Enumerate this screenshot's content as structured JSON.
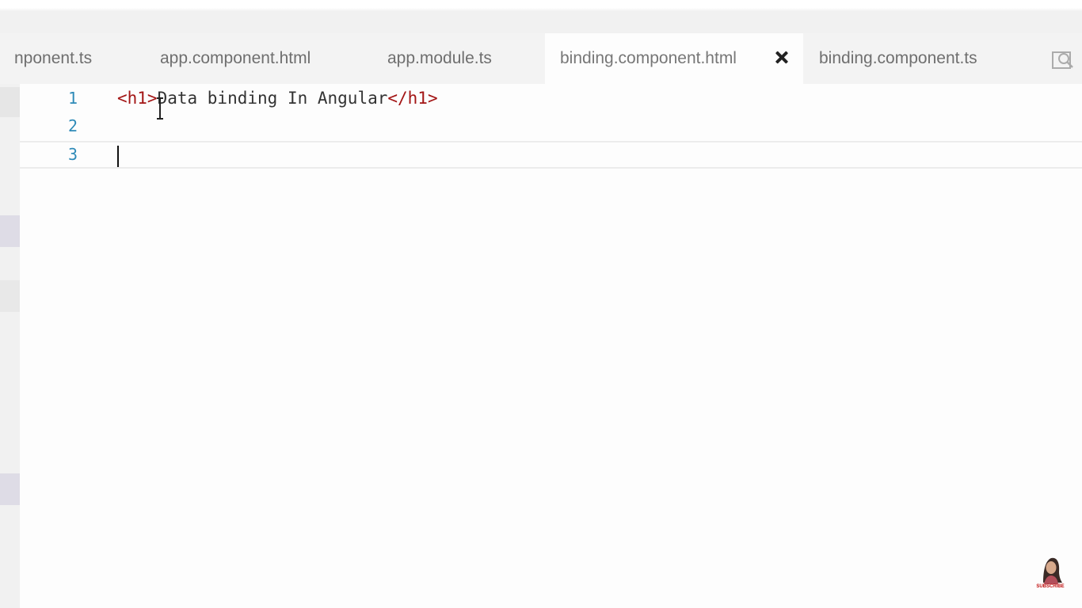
{
  "tabs": [
    {
      "label": "nponent.ts"
    },
    {
      "label": "app.component.html"
    },
    {
      "label": "app.module.ts"
    },
    {
      "label": "binding.component.html",
      "active": true
    },
    {
      "label": "binding.component.ts"
    }
  ],
  "editor": {
    "lines": [
      {
        "number": "1",
        "open_tag": "<h1>",
        "text": "Data binding In Angular",
        "close_tag": "</h1>"
      },
      {
        "number": "2"
      },
      {
        "number": "3"
      }
    ]
  },
  "icons": {
    "close": "close-icon",
    "split_editor": "split-editor-icon",
    "text_cursor": "text-cursor-icon",
    "subscribe_avatar": "subscribe-avatar-icon"
  },
  "watermark": {
    "subscribe_label": "SUBSCRIBE"
  },
  "colors": {
    "line_number": "#2e8ab8",
    "tag": "#a31515",
    "text": "#333333",
    "active_tab": "#fdfdfd",
    "tabbar": "#f3f3f3"
  }
}
